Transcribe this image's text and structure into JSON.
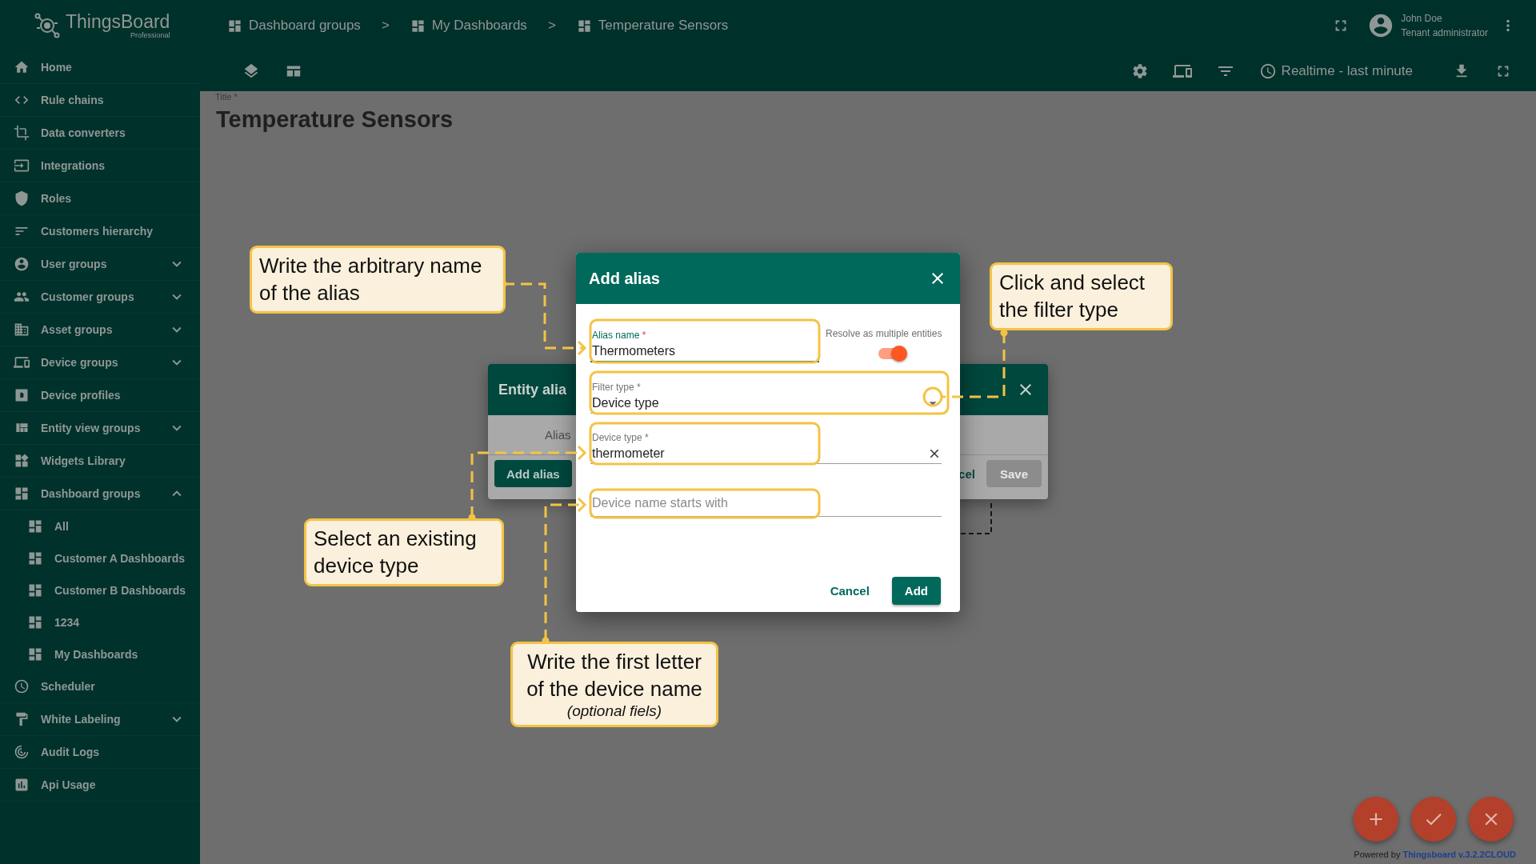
{
  "app": {
    "logo_title": "ThingsBoard",
    "logo_subtitle": "Professional"
  },
  "sidebar": {
    "items": [
      {
        "label": "Home",
        "kind": "link"
      },
      {
        "label": "Rule chains",
        "kind": "link"
      },
      {
        "label": "Data converters",
        "kind": "link"
      },
      {
        "label": "Integrations",
        "kind": "link"
      },
      {
        "label": "Roles",
        "kind": "link"
      },
      {
        "label": "Customers hierarchy",
        "kind": "link"
      },
      {
        "label": "User groups",
        "kind": "group",
        "expanded": false
      },
      {
        "label": "Customer groups",
        "kind": "group",
        "expanded": false
      },
      {
        "label": "Asset groups",
        "kind": "group",
        "expanded": false
      },
      {
        "label": "Device groups",
        "kind": "group",
        "expanded": false
      },
      {
        "label": "Device profiles",
        "kind": "link"
      },
      {
        "label": "Entity view groups",
        "kind": "group",
        "expanded": false
      },
      {
        "label": "Widgets Library",
        "kind": "link"
      },
      {
        "label": "Dashboard groups",
        "kind": "group",
        "expanded": true,
        "children": [
          {
            "label": "All"
          },
          {
            "label": "Customer A Dashboards"
          },
          {
            "label": "Customer B Dashboards"
          },
          {
            "label": "1234"
          },
          {
            "label": "My Dashboards"
          }
        ]
      },
      {
        "label": "Scheduler",
        "kind": "link"
      },
      {
        "label": "White Labeling",
        "kind": "group",
        "expanded": false
      },
      {
        "label": "Audit Logs",
        "kind": "link"
      },
      {
        "label": "Api Usage",
        "kind": "link"
      }
    ]
  },
  "breadcrumbs": {
    "items": [
      "Dashboard groups",
      "My Dashboards",
      "Temperature Sensors"
    ],
    "separators": [
      ">",
      ">"
    ]
  },
  "user": {
    "name": "John Doe",
    "role": "Tenant administrator"
  },
  "toolbar": {
    "timewindow": "Realtime - last minute"
  },
  "dashboard": {
    "title_label": "Title *",
    "title": "Temperature Sensors"
  },
  "entity_alias_dialog": {
    "title": "Entity alia",
    "column_header": "Alias",
    "add_button": "Add alias",
    "cancel_button": "cel",
    "save_button": {
      "label": "Save",
      "disabled": true
    }
  },
  "add_alias_dialog": {
    "title": "Add alias",
    "alias_name": {
      "label": "Alias name",
      "required_mark": "*",
      "value": "Thermometers",
      "focused": true
    },
    "resolve_multiple": {
      "label": "Resolve as multiple entities",
      "on": true
    },
    "filter_type": {
      "label": "Filter type",
      "required_mark": "*",
      "value": "Device type",
      "focused": false
    },
    "device_type": {
      "label": "Device type",
      "required_mark": "*",
      "value": "thermometer",
      "focused": false
    },
    "device_name": {
      "placeholder": "Device name starts with"
    },
    "cancel_button": "Cancel",
    "add_button": "Add"
  },
  "callouts": [
    {
      "text": "Write the arbitrary name of the alias"
    },
    {
      "text": "Click and select the filter type"
    },
    {
      "text": "Select an existing device type"
    },
    {
      "text": "Write the first letter of the device name",
      "note": "(optional fiels)"
    }
  ],
  "footer": {
    "powered_by": "Powered by",
    "link": "Thingsboard v.3.2.2CLOUD"
  }
}
